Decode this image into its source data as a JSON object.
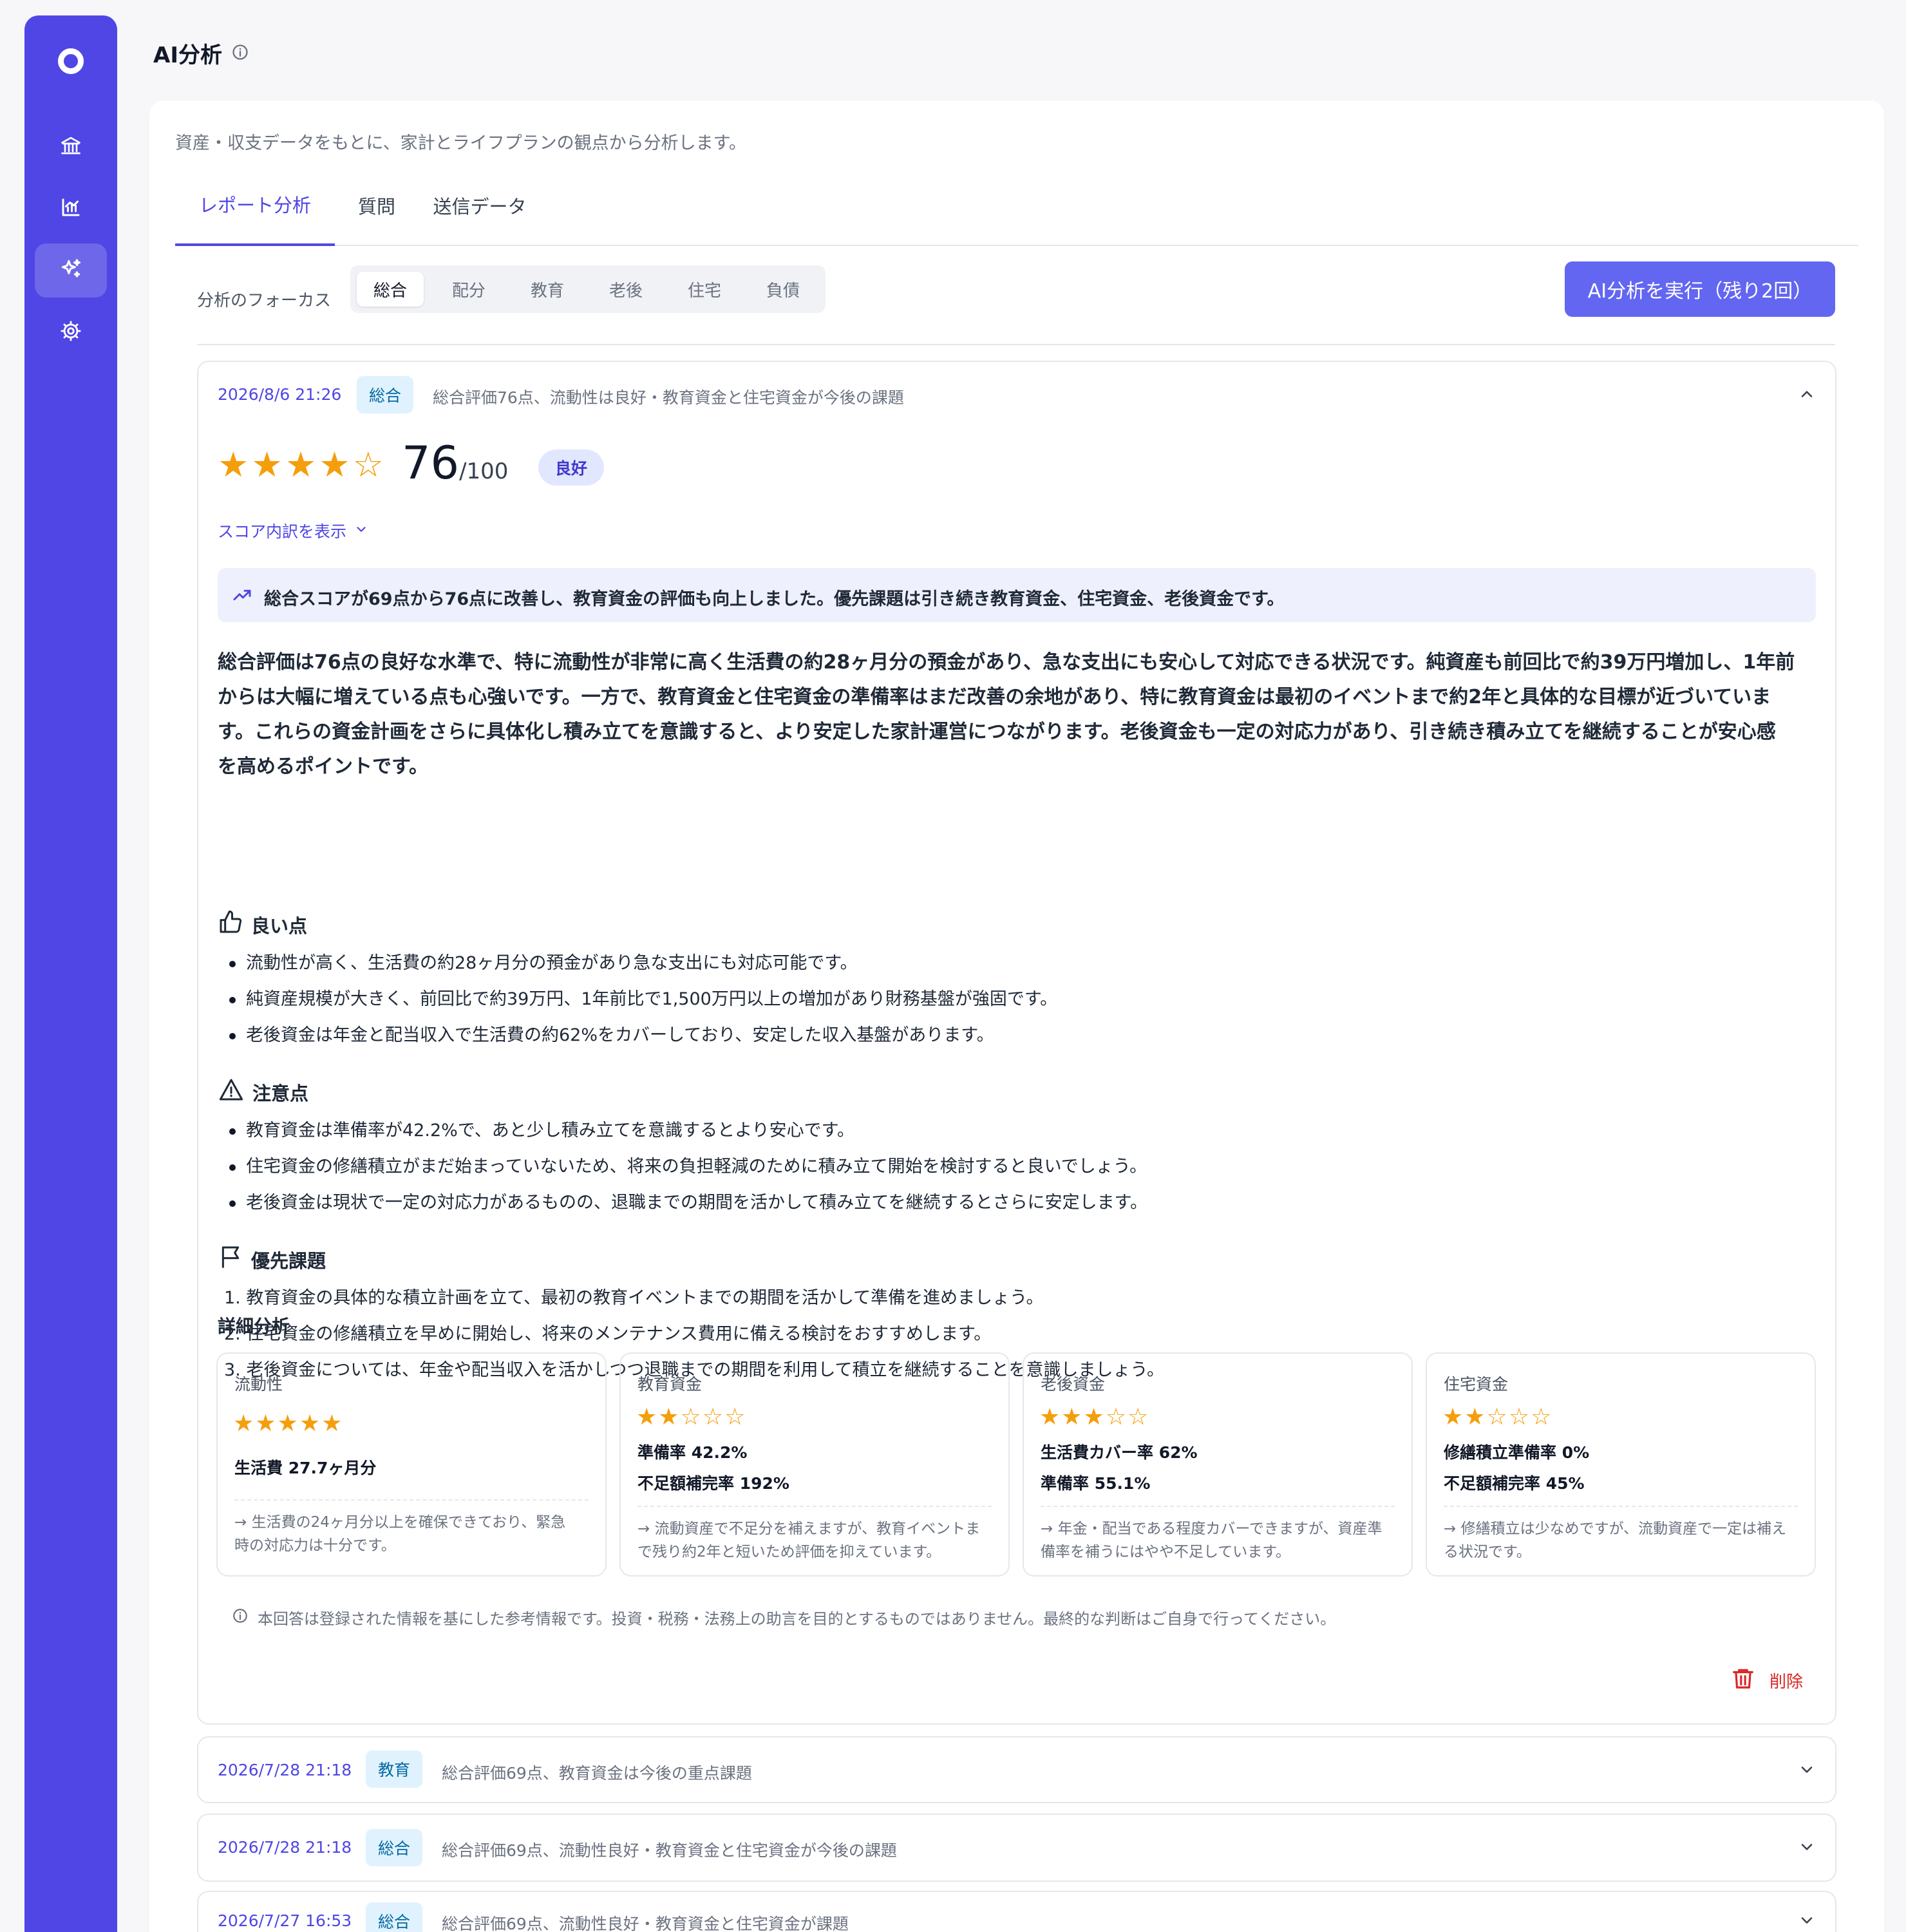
{
  "page": {
    "title": "AI分析"
  },
  "sidebar": {
    "items": [
      "bank-icon",
      "chart-icon",
      "sparkles-icon",
      "settings-icon"
    ],
    "active_index": 2
  },
  "main": {
    "description": "資産・収支データをもとに、家計とライフプランの観点から分析します。",
    "tabs": [
      {
        "label": "レポート分析",
        "active": true
      },
      {
        "label": "質問",
        "active": false
      },
      {
        "label": "送信データ",
        "active": false
      }
    ],
    "focus": {
      "label": "分析のフォーカス",
      "options": [
        "総合",
        "配分",
        "教育",
        "老後",
        "住宅",
        "負債"
      ],
      "selected": "総合"
    },
    "run_button": "AI分析を実行（残り2回）"
  },
  "report": {
    "date": "2026/8/6 21:26",
    "badge": "総合",
    "summary": "総合評価76点、流動性は良好・教育資金と住宅資金が今後の課題",
    "stars": "★★★★☆",
    "rating": 4,
    "score": "76",
    "score_denominator": "/100",
    "score_label": "良好",
    "breakdown_link": "スコア内訳を表示",
    "trend": "総合スコアが69点から76点に改善し、教育資金の評価も向上しました。優先課題は引き続き教育資金、住宅資金、老後資金です。",
    "overview_lines": [
      "総合評価は76点の良好な水準で、特に流動性が非常に高く生活費の約28ヶ月分の預金があり、急な支出にも安心して対応できる状況です。純資産も前回比で約39万円増加し、1年前",
      "からは大幅に増えている点も心強いです。一方で、教育資金と住宅資金の準備率はまだ改善の余地があり、特に教育資金は最初のイベントまで約2年と具体的な目標が近づいていま",
      "す。これらの資金計画をさらに具体化し積み立てを意識すると、より安定した家計運営につながります。老後資金も一定の対応力があり、引き続き積み立てを継続することが安心感",
      "を高めるポイントです。"
    ],
    "good_title": "良い点",
    "good_points": [
      "流動性が高く、生活費の約28ヶ月分の預金があり急な支出にも対応可能です。",
      "純資産規模が大きく、前回比で約39万円、1年前比で1,500万円以上の増加があり財務基盤が強固です。",
      "老後資金は年金と配当収入で生活費の約62%をカバーしており、安定した収入基盤があります。"
    ],
    "caution_title": "注意点",
    "caution_points": [
      "教育資金は準備率が42.2%で、あと少し積み立てを意識するとより安心です。",
      "住宅資金の修繕積立がまだ始まっていないため、将来の負担軽減のために積み立て開始を検討すると良いでしょう。",
      "老後資金は現状で一定の対応力があるものの、退職までの期間を活かして積み立てを継続するとさらに安定します。"
    ],
    "priority_title": "優先課題",
    "priority_items": [
      "1. 教育資金の具体的な積立計画を立て、最初の教育イベントまでの期間を活かして準備を進めましょう。",
      "2. 住宅資金の修繕積立を早めに開始し、将来のメンテナンス費用に備える検討をおすすめします。",
      "3. 老後資金については、年金や配当収入を活かしつつ退職までの期間を利用して積立を継続することを意識しましょう。"
    ],
    "detail_title": "詳細分析",
    "detail_cards": [
      {
        "title": "流動性",
        "stars": "★★★★★",
        "rating": 5,
        "metrics": [
          "生活費 27.7ヶ月分"
        ],
        "note": [
          "→ 生活費の24ヶ月分以上を確保できており、緊急",
          "時の対応力は十分です。"
        ]
      },
      {
        "title": "教育資金",
        "stars": "★★☆☆☆",
        "rating": 2,
        "metrics": [
          "準備率 42.2%",
          "不足額補完率 192%"
        ],
        "note": [
          "→ 流動資産で不足分を補えますが、教育イベントま",
          "で残り約2年と短いため評価を抑えています。"
        ]
      },
      {
        "title": "老後資金",
        "stars": "★★★☆☆",
        "rating": 3,
        "metrics": [
          "生活費カバー率 62%",
          "準備率 55.1%"
        ],
        "note": [
          "→ 年金・配当である程度カバーできますが、資産準",
          "備率を補うにはやや不足しています。"
        ]
      },
      {
        "title": "住宅資金",
        "stars": "★★☆☆☆",
        "rating": 2,
        "metrics": [
          "修繕積立準備率 0%",
          "不足額補完率 45%"
        ],
        "note": [
          "→ 修繕積立は少なめですが、流動資産で一定は補え",
          "る状況です。"
        ]
      }
    ],
    "disclaimer": "本回答は登録された情報を基にした参考情報です。投資・税務・法務上の助言を目的とするものではありません。最終的な判断はご自身で行ってください。",
    "delete_label": "削除"
  },
  "history": [
    {
      "date": "2026/7/28 21:18",
      "badge": "教育",
      "summary": "総合評価69点、教育資金は今後の重点課題"
    },
    {
      "date": "2026/7/28 21:18",
      "badge": "総合",
      "summary": "総合評価69点、流動性良好・教育資金と住宅資金が今後の課題"
    },
    {
      "date": "2026/7/27 16:53",
      "badge": "総合",
      "summary": "総合評価69点、流動性良好・教育資金と住宅資金が課題"
    }
  ],
  "colors": {
    "accent": "#4f46e5",
    "button": "#6366f1",
    "star": "#f59e0b",
    "danger": "#dc2626"
  }
}
